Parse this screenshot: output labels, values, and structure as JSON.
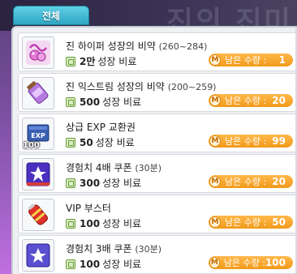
{
  "tab": {
    "label": "전체"
  },
  "watermark": "진의 진미",
  "price_unit": "성장 비료",
  "stock_badge": "M",
  "stock_label": "남은 수량 :",
  "items": [
    {
      "name": "진 하이퍼 성장의 비약",
      "paren": "(260~284)",
      "price": "2만",
      "stock": "1",
      "icon": "hyper-growth-potion-icon"
    },
    {
      "name": "진 익스트림 성장의 비약",
      "paren": "(200~259)",
      "price": "500",
      "stock": "20",
      "icon": "extreme-growth-potion-icon"
    },
    {
      "name": "상급 EXP 교환권",
      "paren": "",
      "price": "50",
      "stock": "99",
      "icon": "exp-coupon-icon",
      "icon_count": "100",
      "icon_text": "EXP"
    },
    {
      "name": "경험치 4배 쿠폰",
      "paren": "(30분)",
      "price": "300",
      "stock": "20",
      "icon": "exp-4x-coupon-icon"
    },
    {
      "name": "VIP 부스터",
      "paren": "",
      "price": "100",
      "stock": "50",
      "icon": "vip-booster-icon"
    },
    {
      "name": "경험치 3배 쿠폰",
      "paren": "(30분)",
      "price": "100",
      "stock": "100",
      "icon": "exp-3x-coupon-icon"
    }
  ],
  "colors": {
    "tab": "#2fa6c4",
    "stock": "#f29a1a",
    "price_icon": "#6a9a3a"
  }
}
